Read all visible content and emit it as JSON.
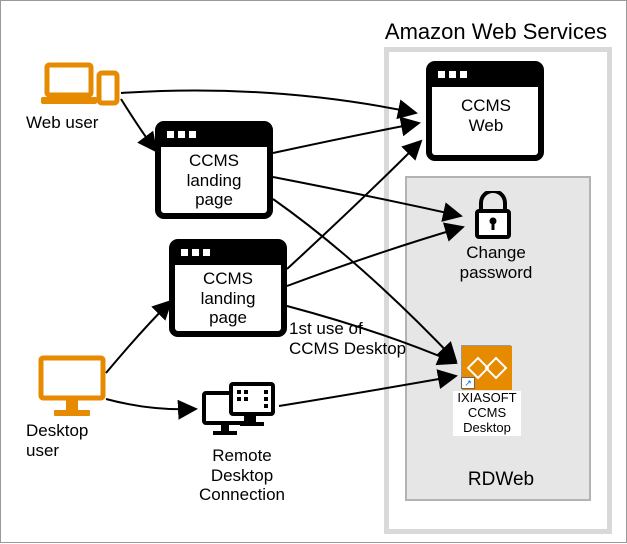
{
  "title": "Amazon Web Services",
  "web_user_label": "Web user",
  "desktop_user_label": "Desktop\nuser",
  "landing_page_1_label": "CCMS\nlanding\npage",
  "landing_page_2_label": "CCMS\nlanding\npage",
  "remote_desktop_label": "Remote\nDesktop\nConnection",
  "ccms_web_label": "CCMS\nWeb",
  "change_password_label": "Change\npassword",
  "ixiasoft_label": "IXIASOFT\nCCMS\nDesktop",
  "rdweb_label": "RDWeb",
  "first_use_label": "1st use of\nCCMS Desktop",
  "colors": {
    "accent": "#E68A00",
    "black": "#000000",
    "grey_bg": "#D9D9D9",
    "light_grey": "#B3B3B3"
  }
}
